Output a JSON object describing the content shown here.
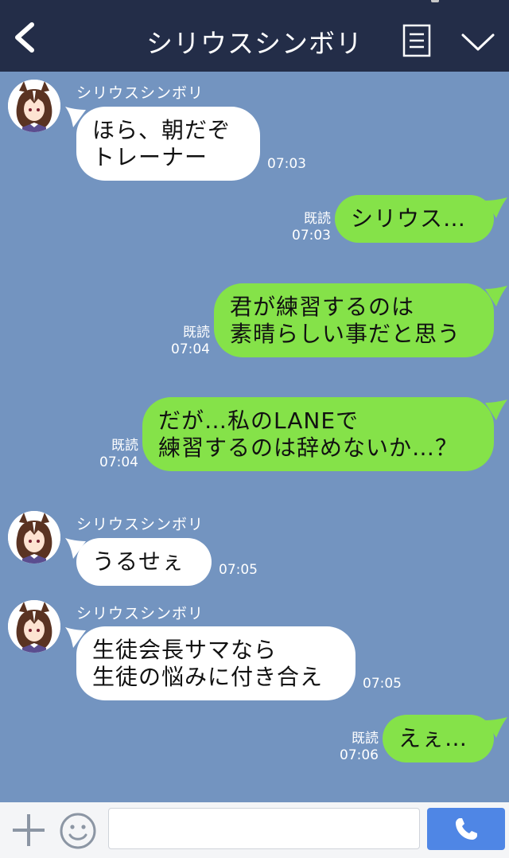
{
  "header": {
    "title": "シリウスシンボリ",
    "icons": [
      "back-chevron-icon",
      "menu-list-icon",
      "chevron-down-icon"
    ],
    "background": "#232d48"
  },
  "chat": {
    "background": "#7394c0",
    "incoming_color": "#ffffff",
    "outgoing_color": "#85e249",
    "messages": [
      {
        "direction": "in",
        "sender": "シリウスシンボリ",
        "lines": [
          "ほら、朝だぞ",
          "トレーナー"
        ],
        "time": "07:03"
      },
      {
        "direction": "out",
        "read": "既読",
        "lines": [
          "シリウス…"
        ],
        "time": "07:03"
      },
      {
        "direction": "out",
        "read": "既読",
        "lines": [
          "君が練習するのは",
          "素晴らしい事だと思う"
        ],
        "time": "07:04"
      },
      {
        "direction": "out",
        "read": "既読",
        "lines": [
          "だが…私のLANEで",
          "練習するのは辞めないか…？"
        ],
        "time": "07:04"
      },
      {
        "direction": "in",
        "sender": "シリウスシンボリ",
        "lines": [
          "うるせぇ"
        ],
        "time": "07:05"
      },
      {
        "direction": "in",
        "sender": "シリウスシンボリ",
        "lines": [
          "生徒会長サマなら",
          "生徒の悩みに付き合え"
        ],
        "time": "07:05"
      },
      {
        "direction": "out",
        "read": "既読",
        "lines": [
          "えぇ…"
        ],
        "time": "07:06"
      }
    ]
  },
  "footer": {
    "input_value": "",
    "icons": [
      "plus-icon",
      "smile-icon",
      "phone-icon"
    ],
    "call_color": "#4f86e5"
  }
}
